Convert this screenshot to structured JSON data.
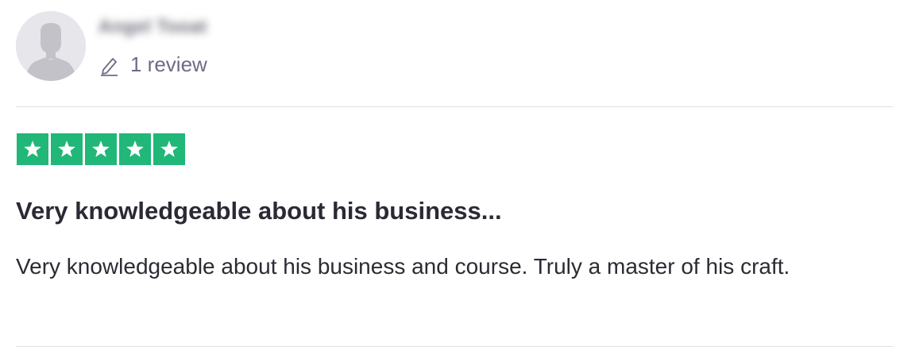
{
  "reviewer": {
    "name": "Angel Tooat",
    "review_count": "1 review"
  },
  "rating": {
    "value": 5,
    "max": 5,
    "star_color": "#20b778"
  },
  "review": {
    "title": "Very knowledgeable about his business...",
    "body": "Very knowledgeable about his business and course. Truly a master of his craft."
  },
  "icons": {
    "avatar": "default-user-avatar-icon",
    "pencil": "pencil-icon",
    "star": "star-icon"
  }
}
